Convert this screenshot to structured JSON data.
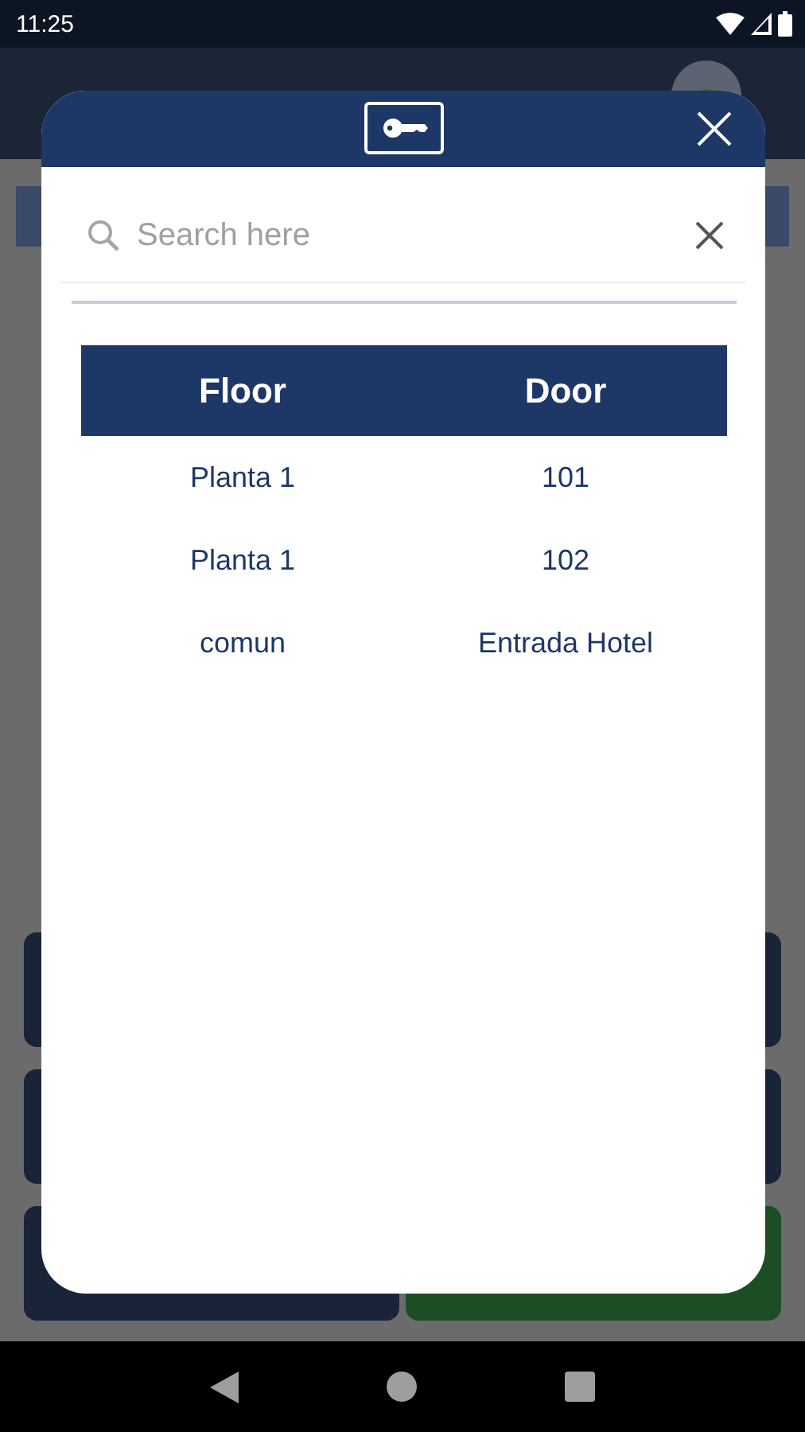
{
  "status_bar": {
    "time": "11:25"
  },
  "dialog": {
    "search": {
      "placeholder": "Search here"
    },
    "table": {
      "columns": [
        "Floor",
        "Door"
      ],
      "rows": [
        [
          "Planta 1",
          "101"
        ],
        [
          "Planta 1",
          "102"
        ],
        [
          "comun",
          "Entrada Hotel"
        ]
      ]
    }
  }
}
